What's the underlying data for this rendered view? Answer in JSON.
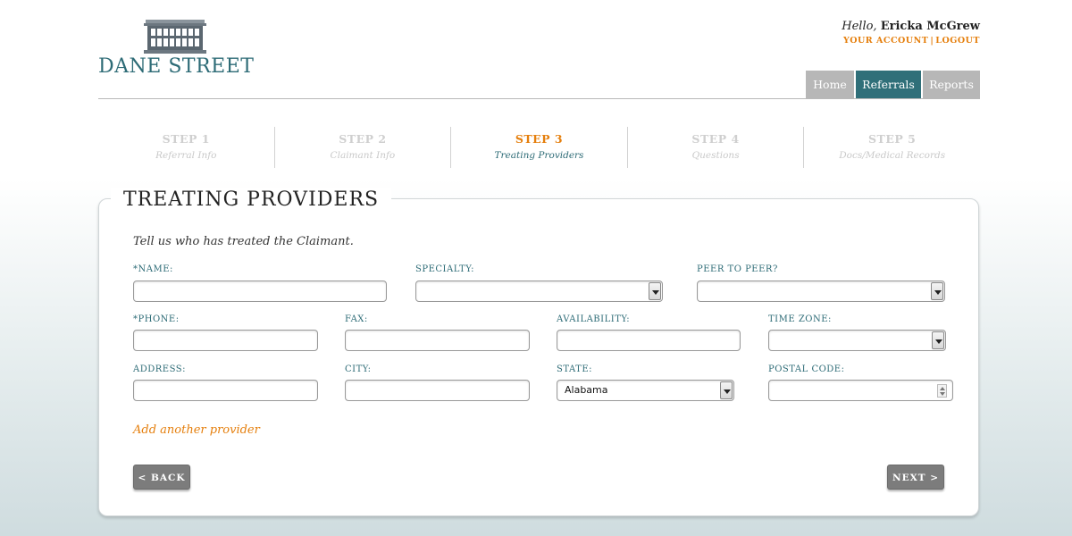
{
  "brand": {
    "name": "DANE STREET"
  },
  "user": {
    "hello": "Hello,",
    "name": "Ericka McGrew"
  },
  "account_links": {
    "account": "YOUR ACCOUNT",
    "separator": "|",
    "logout": "LOGOUT"
  },
  "nav": {
    "home": "Home",
    "referrals": "Referrals",
    "reports": "Reports"
  },
  "steps": [
    {
      "title": "STEP 1",
      "subtitle": "Referral Info"
    },
    {
      "title": "STEP 2",
      "subtitle": "Claimant Info"
    },
    {
      "title": "STEP 3",
      "subtitle": "Treating Providers"
    },
    {
      "title": "STEP 4",
      "subtitle": "Questions"
    },
    {
      "title": "STEP 5",
      "subtitle": "Docs/Medical Records"
    }
  ],
  "form": {
    "title": "TREATING PROVIDERS",
    "intro": "Tell us who has treated the Claimant.",
    "labels": {
      "name": "*NAME:",
      "specialty": "SPECIALTY:",
      "peer": "PEER TO PEER?",
      "phone": "*PHONE:",
      "fax": "FAX:",
      "availability": "AVAILABILITY:",
      "timezone": "TIME ZONE:",
      "address": "ADDRESS:",
      "city": "CITY:",
      "state": "STATE:",
      "postal": "POSTAL CODE:"
    },
    "values": {
      "state": "Alabama"
    },
    "add_link": "Add another provider",
    "back": "< BACK",
    "next": "NEXT >"
  },
  "colors": {
    "accent": "#e57f0d",
    "brand": "#2f6f79",
    "nav_inactive": "#b7b7b7",
    "button": "#7c7c7c"
  }
}
